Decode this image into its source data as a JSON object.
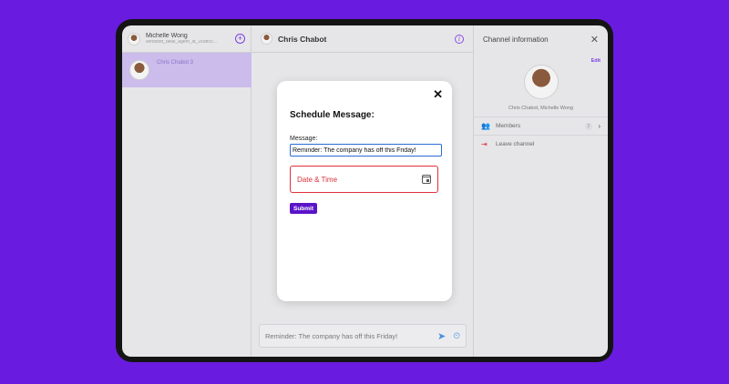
{
  "sidebar": {
    "user_name": "Michelle Wong",
    "user_id": "sendbird_desk_agent_id_1f0dfc5...",
    "channels": [
      {
        "name": "Chris Chabot 3"
      }
    ]
  },
  "main": {
    "title": "Chris Chabot",
    "composer_value": "Reminder: The company has off this Friday!",
    "icons": {
      "send": "send-icon",
      "schedule": "schedule-send-icon",
      "info": "info-icon"
    }
  },
  "panel": {
    "title": "Channel information",
    "edit_label": "Edit",
    "members_line": "Chris Chabot, Michelle Wong",
    "members_label": "Members",
    "members_count": "2",
    "leave_label": "Leave channel"
  },
  "modal": {
    "title": "Schedule Message:",
    "message_label": "Message:",
    "message_value": "Reminder: The company has off this Friday!",
    "date_label": "Date & Time",
    "submit_label": "Submit",
    "close_glyph": "✕"
  },
  "colors": {
    "background": "#6a1be0",
    "accent": "#5a14c8",
    "error": "#e0303a",
    "selected_channel": "#cbbcec"
  }
}
